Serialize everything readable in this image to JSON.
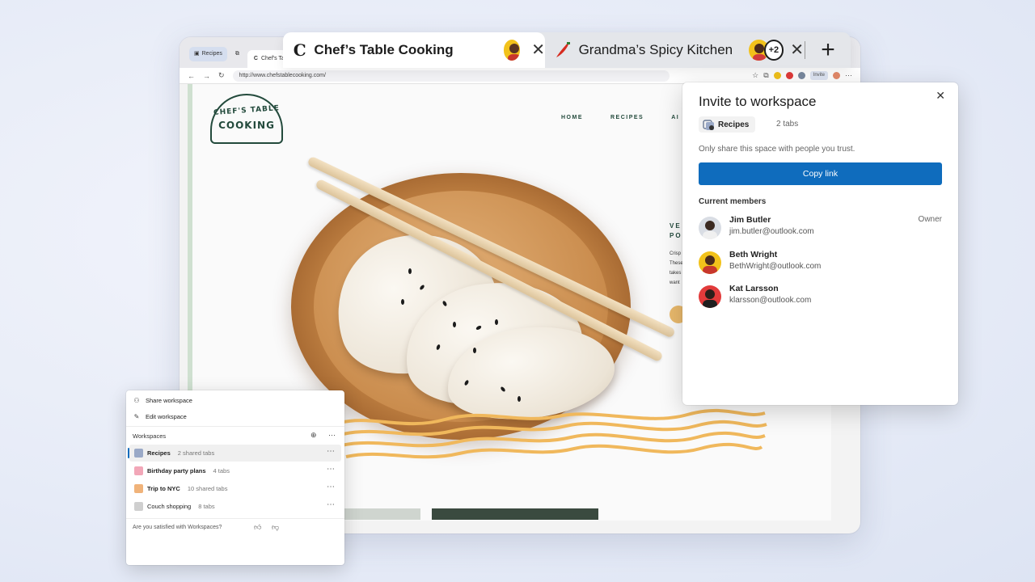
{
  "mini_browser": {
    "workspace_chip": "Recipes",
    "active_tab": "Chef's Ta",
    "url": "http://www.chefstablecooking.com/",
    "invite_label": "Invite"
  },
  "site": {
    "logo_line1": "CHEF'S TABLE",
    "logo_line2": "COOKING",
    "nav": [
      "HOME",
      "RECIPES",
      "AI"
    ],
    "side_heading_1": "VE",
    "side_heading_2": "PO",
    "side_text": [
      "Crisp",
      "These",
      "takes",
      "want"
    ]
  },
  "tabs": {
    "active": {
      "title": "Chef’s Table Cooking",
      "favicon_letter": "C"
    },
    "inactive": {
      "title": "Grandma’s Spicy Kitchen",
      "extra_count": "+2"
    }
  },
  "invite": {
    "title": "Invite to workspace",
    "workspace_name": "Recipes",
    "tab_count": "2 tabs",
    "trust_note": "Only share this space with people you trust.",
    "copy_label": "Copy link",
    "members_heading": "Current members",
    "members": [
      {
        "name": "Jim Butler",
        "email": "jim.butler@outlook.com",
        "role": "Owner",
        "avatar_color": "#d9dde4"
      },
      {
        "name": "Beth Wright",
        "email": "BethWright@outlook.com",
        "role": "",
        "avatar_color": "#f2c21b"
      },
      {
        "name": "Kat Larsson",
        "email": "klarsson@outlook.com",
        "role": "",
        "avatar_color": "#e23b3b"
      }
    ]
  },
  "ws_menu": {
    "share_label": "Share workspace",
    "edit_label": "Edit workspace",
    "heading": "Workspaces",
    "items": [
      {
        "name": "Recipes",
        "count": "2 shared tabs",
        "color": "#9aa9c7"
      },
      {
        "name": "Birthday party plans",
        "count": "4 tabs",
        "color": "#f2a7b8"
      },
      {
        "name": "Trip to NYC",
        "count": "10 shared tabs",
        "color": "#f0b37a"
      },
      {
        "name": "Couch shopping",
        "count": "8 tabs",
        "color": "#cfcfcf"
      }
    ],
    "feedback": "Are you satisfied with Workspaces?"
  },
  "colors": {
    "accent": "#0f6cbd",
    "background": "#e9edf8"
  }
}
